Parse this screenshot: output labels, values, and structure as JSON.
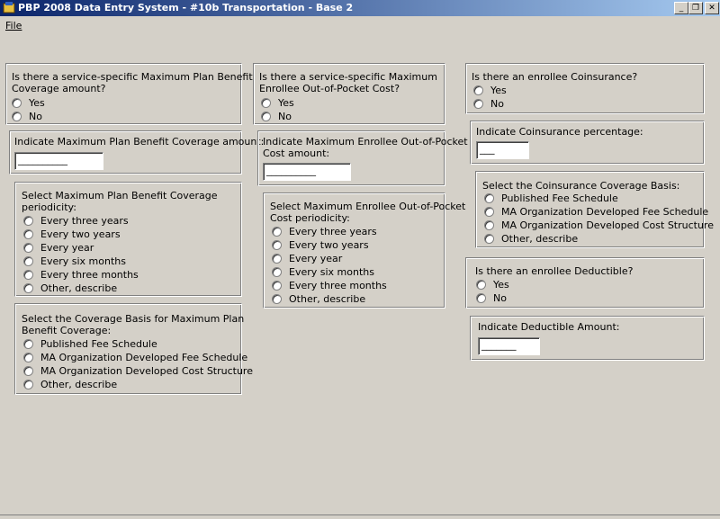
{
  "window": {
    "title": "PBP 2008 Data Entry System - #10b Transportation - Base 2",
    "buttons": {
      "minimize": "_",
      "restore": "❐",
      "close": "✕"
    }
  },
  "menu": {
    "file": "File"
  },
  "col1": {
    "max_benefit": {
      "question": [
        "Is there a service-specific Maximum Plan Benefit",
        "Coverage amount?"
      ],
      "options": [
        "Yes",
        "No"
      ]
    },
    "max_benefit_amount": {
      "label": "Indicate Maximum Plan Benefit Coverage amount:",
      "value": "__________"
    },
    "periodicity": {
      "question": [
        "Select Maximum Plan Benefit Coverage",
        "periodicity:"
      ],
      "options": [
        "Every three years",
        "Every two years",
        "Every year",
        "Every six months",
        "Every three months",
        "Other, describe"
      ]
    },
    "coverage_basis": {
      "question": [
        "Select the Coverage Basis for Maximum Plan",
        "Benefit Coverage:"
      ],
      "options": [
        "Published Fee Schedule",
        "MA Organization Developed Fee Schedule",
        "MA Organization Developed Cost Structure",
        "Other, describe"
      ]
    }
  },
  "col2": {
    "max_oop": {
      "question": [
        "Is there a service-specific Maximum",
        "Enrollee Out-of-Pocket Cost?"
      ],
      "options": [
        "Yes",
        "No"
      ]
    },
    "max_oop_amount": {
      "label": [
        "Indicate Maximum Enrollee Out-of-Pocket",
        "Cost amount:"
      ],
      "value": "__________"
    },
    "oop_periodicity": {
      "question": [
        "Select Maximum Enrollee Out-of-Pocket",
        "Cost periodicity:"
      ],
      "options": [
        "Every three years",
        "Every two years",
        "Every year",
        "Every six months",
        "Every three months",
        "Other, describe"
      ]
    }
  },
  "col3": {
    "coinsurance": {
      "question": "Is there an enrollee Coinsurance?",
      "options": [
        "Yes",
        "No"
      ]
    },
    "coinsurance_pct": {
      "label": "Indicate Coinsurance percentage:",
      "value": "___"
    },
    "coinsurance_basis": {
      "question": "Select the Coinsurance Coverage Basis:",
      "options": [
        "Published Fee Schedule",
        "MA Organization Developed Fee Schedule",
        "MA Organization Developed Cost Structure",
        "Other, describe"
      ]
    },
    "deductible": {
      "question": "Is there an enrollee Deductible?",
      "options": [
        "Yes",
        "No"
      ]
    },
    "deductible_amount": {
      "label": "Indicate Deductible Amount:",
      "value": "_______"
    }
  }
}
